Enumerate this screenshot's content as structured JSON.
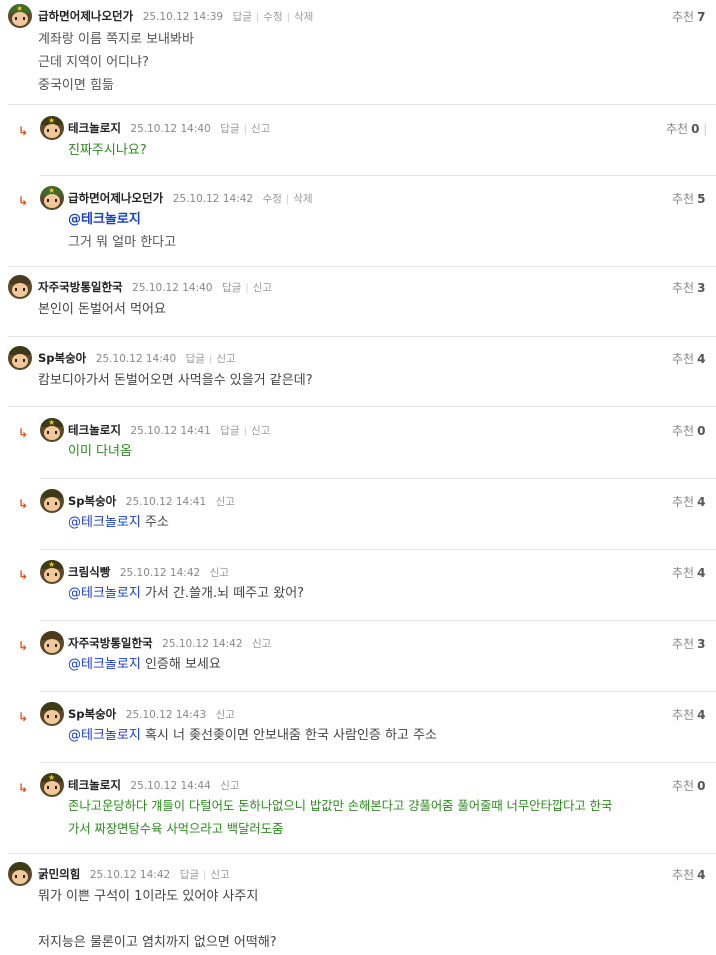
{
  "recommend_label": "추천",
  "reply_label": "답글",
  "edit_label": "수정",
  "delete_label": "삭제",
  "report_label": "신고",
  "comments": [
    {
      "nick": "급하면어제나오던가",
      "date": "25.10.12 14:39",
      "rec": "7",
      "lines": [
        "계좌랑 이름 쪽지로 보내봐바",
        "근데 지역이 어디냐?",
        "중국이면 힘듦"
      ]
    },
    {
      "nick": "테크놀로지",
      "date": "25.10.12 14:40",
      "rec": "0",
      "lines": [
        "진짜주시나요?"
      ]
    },
    {
      "nick": "급하면어제나오던가",
      "date": "25.10.12 14:42",
      "rec": "5",
      "mention": "@테크놀로지",
      "lines": [
        "그거 뭐 얼마 한다고"
      ]
    },
    {
      "nick": "자주국방통일한국",
      "date": "25.10.12 14:40",
      "rec": "3",
      "lines": [
        "본인이 돈벌어서 먹어요"
      ]
    },
    {
      "nick": "Sp복숭아",
      "date": "25.10.12 14:40",
      "rec": "4",
      "lines": [
        "캄보디아가서 돈벌어오면 사먹을수 있을거 같은데?"
      ]
    },
    {
      "nick": "테크놀로지",
      "date": "25.10.12 14:41",
      "rec": "0",
      "lines": [
        "이미 다녀옴"
      ]
    },
    {
      "nick": "Sp복숭아",
      "date": "25.10.12 14:41",
      "rec": "4",
      "mention": "@테크놀로지",
      "lines": [
        "주소"
      ]
    },
    {
      "nick": "크림식빵",
      "date": "25.10.12 14:42",
      "rec": "4",
      "mention": "@테크놀로지",
      "lines": [
        "가서 간.쓸개.뇌 떼주고 왔어?"
      ]
    },
    {
      "nick": "자주국방통일한국",
      "date": "25.10.12 14:42",
      "rec": "3",
      "mention": "@테크놀로지",
      "lines": [
        "인증해 보세요"
      ]
    },
    {
      "nick": "Sp복숭아",
      "date": "25.10.12 14:43",
      "rec": "4",
      "mention": "@테크놀로지",
      "lines": [
        "혹시 너 좆선좆이면 안보내줌 한국 사람인증 하고 주소"
      ]
    },
    {
      "nick": "테크놀로지",
      "date": "25.10.12 14:44",
      "rec": "0",
      "lines": [
        "존나고운당하다 걔들이 다털어도 돈하나없으니 밥값만 손해본다고 걍풀어줌 풀어줄때 너무안타깝다고 한국",
        "가서 짜장면탕수육 사먹으라고 백달러도줌"
      ]
    },
    {
      "nick": "굵민의힘",
      "date": "25.10.12 14:42",
      "rec": "4",
      "lines": [
        "뭐가 이쁜 구석이 1이라도 있어야 사주지",
        "",
        "저지능은 물론이고 염치까지 없으면 어떡해?"
      ]
    }
  ]
}
